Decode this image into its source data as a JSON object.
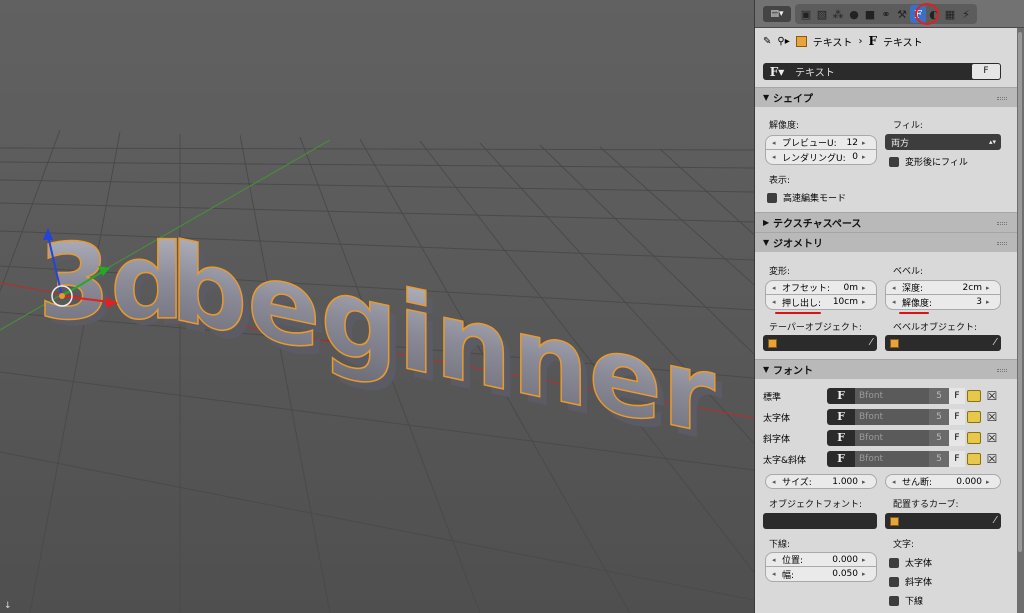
{
  "viewport": {
    "text_object": "3d beginner"
  },
  "header": {
    "editor_type_icon": "properties-editor-icon",
    "tabs": [
      "render-icon",
      "render-layers-icon",
      "scene-icon",
      "world-icon",
      "object-icon",
      "constraints-icon",
      "modifiers-icon",
      "data-font-icon",
      "material-icon",
      "texture-icon",
      "physics-icon"
    ],
    "active_tab": "data-font-icon"
  },
  "breadcrumb": {
    "object_name": "テキスト",
    "data_name": "テキスト"
  },
  "datablock": {
    "name": "テキスト",
    "fake_user": "F"
  },
  "shape": {
    "title": "シェイプ",
    "resolution_label": "解像度:",
    "preview_u": {
      "label": "プレビューU:",
      "value": "12"
    },
    "render_u": {
      "label": "レンダリングU:",
      "value": "0"
    },
    "fill_label": "フィル:",
    "fill_value": "両方",
    "fill_deform": "変形後にフィル",
    "display_label": "表示:",
    "fast_edit": "高速編集モード"
  },
  "texture_space": {
    "title": "テクスチャスペース"
  },
  "geometry": {
    "title": "ジオメトリ",
    "modification_label": "変形:",
    "offset": {
      "label": "オフセット:",
      "value": "0m"
    },
    "extrude": {
      "label": "押し出し:",
      "value": "10cm"
    },
    "bevel_label": "ベベル:",
    "depth": {
      "label": "深度:",
      "value": "2cm"
    },
    "resolution": {
      "label": "解像度:",
      "value": "3"
    },
    "taper_label": "テーパーオブジェクト:",
    "bevel_object_label": "ベベルオブジェクト:"
  },
  "font": {
    "title": "フォント",
    "rows": [
      {
        "label": "標準",
        "font": "Bfont",
        "users": "5",
        "fake": "F"
      },
      {
        "label": "太字体",
        "font": "Bfont",
        "users": "5",
        "fake": "F"
      },
      {
        "label": "斜字体",
        "font": "Bfont",
        "users": "5",
        "fake": "F"
      },
      {
        "label": "太字&斜体",
        "font": "Bfont",
        "users": "5",
        "fake": "F"
      }
    ],
    "size": {
      "label": "サイズ:",
      "value": "1.000"
    },
    "shear": {
      "label": "せん断:",
      "value": "0.000"
    },
    "object_font_label": "オブジェクトフォント:",
    "text_on_curve_label": "配置するカーブ:",
    "underline_label": "下線:",
    "underline_position": {
      "label": "位置:",
      "value": "0.000"
    },
    "underline_thickness": {
      "label": "幅:",
      "value": "0.050"
    },
    "character_label": "文字:",
    "char_bold": "太字体",
    "char_italic": "斜字体",
    "char_underline": "下線"
  },
  "colors": {
    "annotation_red": "#d11111",
    "active_tab": "#3a6fc4",
    "selection_outline": "#e89a2c"
  }
}
